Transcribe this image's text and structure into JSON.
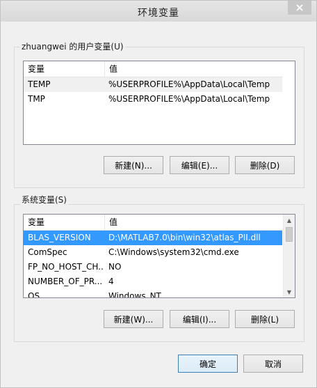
{
  "window": {
    "title": "环境变量",
    "close_label": "✕"
  },
  "user_vars": {
    "group_label": "zhuangwei 的用户变量(U)",
    "headers": {
      "name": "变量",
      "value": "值"
    },
    "rows": [
      {
        "name": "TEMP",
        "value": "%USERPROFILE%\\AppData\\Local\\Temp"
      },
      {
        "name": "TMP",
        "value": "%USERPROFILE%\\AppData\\Local\\Temp"
      }
    ],
    "buttons": {
      "new": "新建(N)...",
      "edit": "编辑(E)...",
      "delete": "删除(D)"
    }
  },
  "system_vars": {
    "group_label": "系统变量(S)",
    "headers": {
      "name": "变量",
      "value": "值"
    },
    "rows": [
      {
        "name": "BLAS_VERSION",
        "value": "D:\\MATLAB7.0\\bin\\win32\\atlas_PII.dll",
        "selected": true
      },
      {
        "name": "ComSpec",
        "value": "C:\\Windows\\system32\\cmd.exe"
      },
      {
        "name": "FP_NO_HOST_CH...",
        "value": "NO"
      },
      {
        "name": "NUMBER_OF_PR...",
        "value": "4"
      },
      {
        "name": "OS",
        "value": "Windows_NT"
      }
    ],
    "buttons": {
      "new": "新建(W)...",
      "edit": "编辑(I)...",
      "delete": "删除(L)"
    }
  },
  "dialog_buttons": {
    "ok": "确定",
    "cancel": "取消"
  }
}
